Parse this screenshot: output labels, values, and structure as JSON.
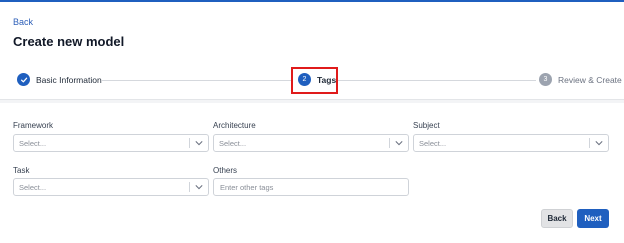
{
  "header": {
    "back_label": "Back",
    "title": "Create new model"
  },
  "stepper": {
    "steps": [
      {
        "number": "",
        "label": "Basic Information",
        "state": "done"
      },
      {
        "number": "2",
        "label": "Tags",
        "state": "active"
      },
      {
        "number": "3",
        "label": "Review & Create",
        "state": "pending"
      }
    ]
  },
  "form": {
    "framework": {
      "label": "Framework",
      "placeholder": "Select..."
    },
    "architecture": {
      "label": "Architecture",
      "placeholder": "Select..."
    },
    "subject": {
      "label": "Subject",
      "placeholder": "Select..."
    },
    "task": {
      "label": "Task",
      "placeholder": "Select..."
    },
    "others": {
      "label": "Others",
      "placeholder": "Enter other tags"
    }
  },
  "actions": {
    "back_label": "Back",
    "next_label": "Next"
  },
  "colors": {
    "accent": "#1f5fbf",
    "highlight": "#e01b1b"
  },
  "icons": {
    "step_done": "checkmark-icon",
    "dropdown": "chevron-down-icon"
  }
}
